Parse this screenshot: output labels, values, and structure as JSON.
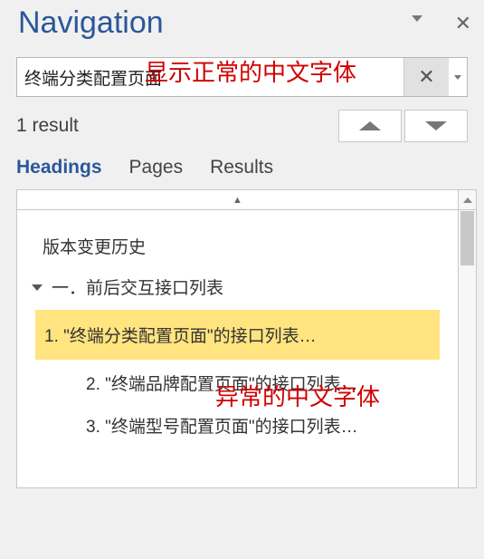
{
  "title": "Navigation",
  "search": {
    "value": "终端分类配置页面",
    "placeholder": ""
  },
  "result_text": "1 result",
  "tabs": {
    "headings": "Headings",
    "pages": "Pages",
    "results": "Results"
  },
  "tree": {
    "item0": "版本变更历史",
    "item1": "一．前后交互接口列表",
    "item1_1": "1. \"终端分类配置页面\"的接口列表…",
    "item1_2": "2. \"终端品牌配置页面\"的接口列表…",
    "item1_3": "3. \"终端型号配置页面\"的接口列表…"
  },
  "annotations": {
    "top": "显示正常的中文字体",
    "bottom": "异常的中文字体"
  }
}
